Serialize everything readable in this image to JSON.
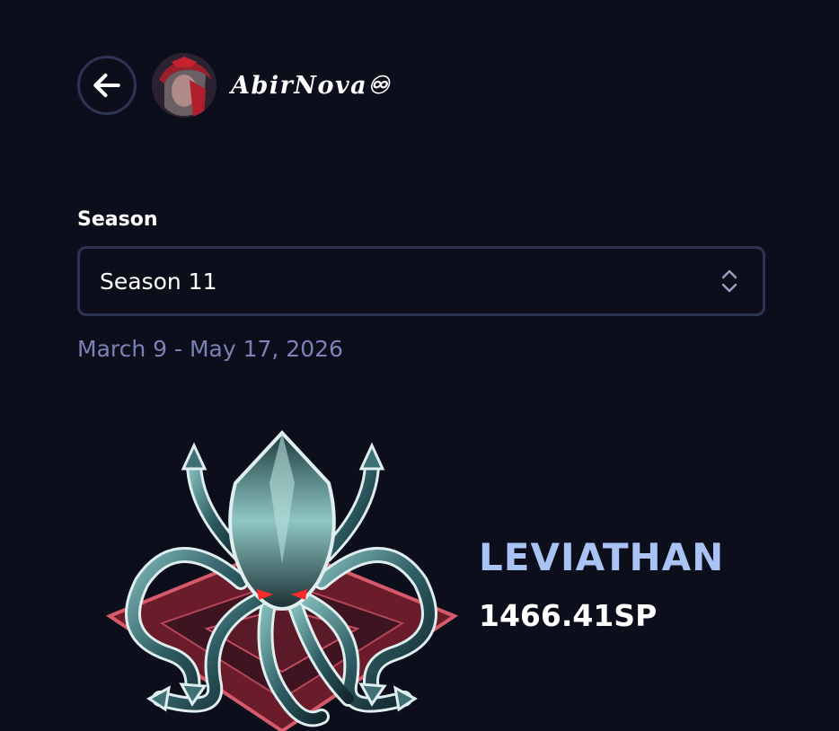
{
  "header": {
    "back_icon": "arrow-left-icon",
    "username": "AbirNova♾"
  },
  "season": {
    "label": "Season",
    "selected": "Season 11",
    "dates": "March 9 - May 17, 2026",
    "select_icon": "chevron-up-down-icon"
  },
  "rank": {
    "name": "LEVIATHAN",
    "points": "1466.41SP",
    "emblem_icon": "kraken-emblem-icon"
  },
  "colors": {
    "background": "#0c0e1b",
    "border": "#2e3554",
    "dates_text": "#7b82b4",
    "rank_accent": "#a9c3f5"
  }
}
